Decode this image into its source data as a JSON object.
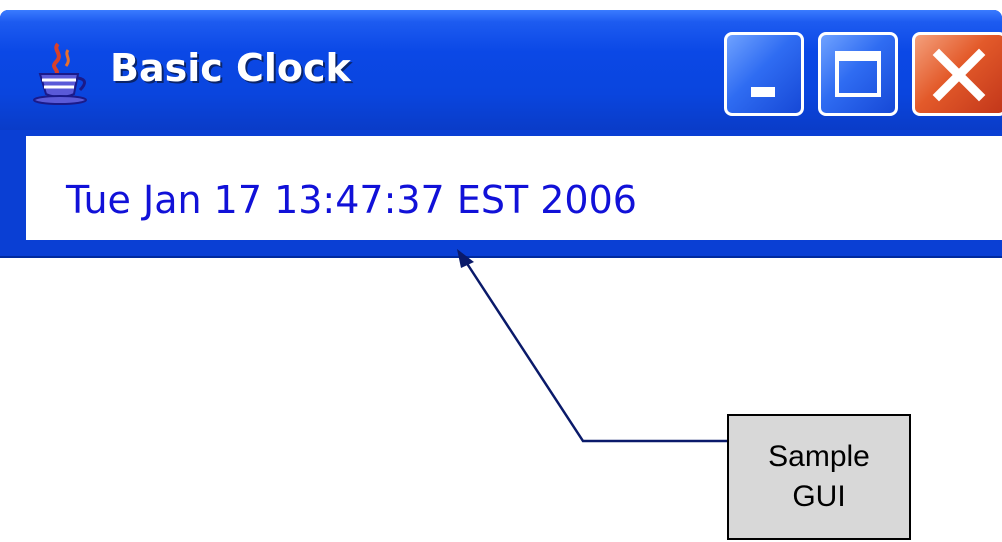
{
  "window": {
    "title": "Basic Clock",
    "icon": "java-coffee-cup-icon",
    "buttons": {
      "minimize": "minimize-icon",
      "maximize": "maximize-icon",
      "close": "close-icon"
    },
    "colors": {
      "titlebar": "#0a45de",
      "close_button": "#e35a2a",
      "clock_text": "#1111d8"
    }
  },
  "clock": {
    "text": "Tue Jan 17 13:47:37 EST 2006"
  },
  "annotation": {
    "line1": "Sample",
    "line2": "GUI"
  }
}
